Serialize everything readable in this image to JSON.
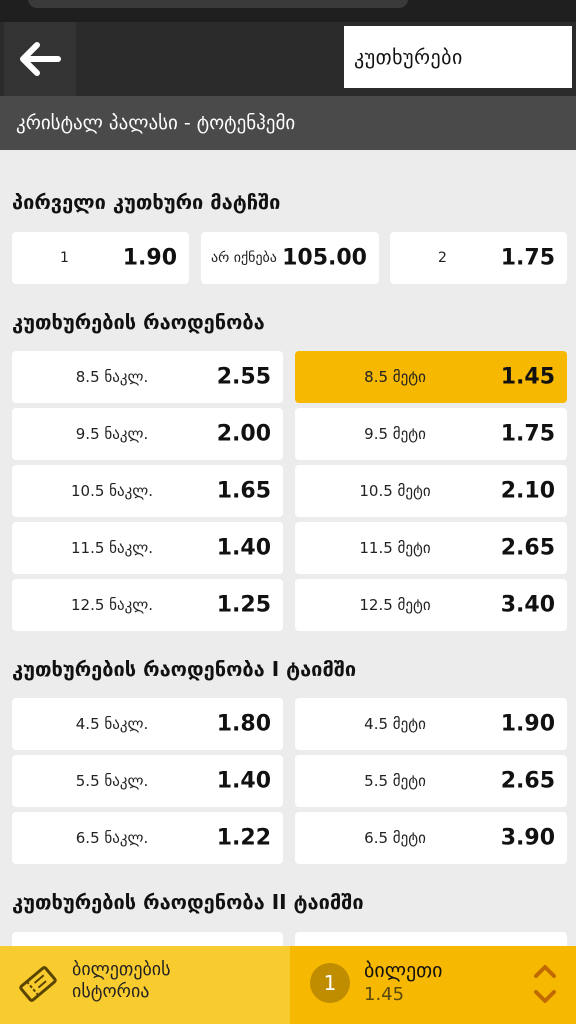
{
  "header": {
    "tab_label": "კუთხურები",
    "match_title": "კრისტალ პალასი - ტოტენჰემი"
  },
  "first_corner": {
    "title": "პირველი კუთხური მატჩში",
    "options": [
      {
        "label": "1",
        "odd": "1.90"
      },
      {
        "label": "არ იქნება",
        "odd": "105.00"
      },
      {
        "label": "2",
        "odd": "1.75"
      }
    ]
  },
  "total_corners": {
    "title": "კუთხურების რაოდენობა",
    "rows": [
      {
        "under_label": "8.5 ნაკლ.",
        "under_odd": "2.55",
        "over_label": "8.5 მეტი",
        "over_odd": "1.45"
      },
      {
        "under_label": "9.5 ნაკლ.",
        "under_odd": "2.00",
        "over_label": "9.5 მეტი",
        "over_odd": "1.75"
      },
      {
        "under_label": "10.5 ნაკლ.",
        "under_odd": "1.65",
        "over_label": "10.5 მეტი",
        "over_odd": "2.10"
      },
      {
        "under_label": "11.5 ნაკლ.",
        "under_odd": "1.40",
        "over_label": "11.5 მეტი",
        "over_odd": "2.65"
      },
      {
        "under_label": "12.5 ნაკლ.",
        "under_odd": "1.25",
        "over_label": "12.5 მეტი",
        "over_odd": "3.40"
      }
    ]
  },
  "first_half": {
    "title": "კუთხურების რაოდენობა I ტაიმში",
    "rows": [
      {
        "under_label": "4.5 ნაკლ.",
        "under_odd": "1.80",
        "over_label": "4.5 მეტი",
        "over_odd": "1.90"
      },
      {
        "under_label": "5.5 ნაკლ.",
        "under_odd": "1.40",
        "over_label": "5.5 მეტი",
        "over_odd": "2.65"
      },
      {
        "under_label": "6.5 ნაკლ.",
        "under_odd": "1.22",
        "over_label": "6.5 მეტი",
        "over_odd": "3.90"
      }
    ]
  },
  "second_half": {
    "title": "კუთხურების რაოდენობა II ტაიმში"
  },
  "footer": {
    "history_label_line1": "ბილეთების",
    "history_label_line2": "ისტორია",
    "ticket_count": "1",
    "ticket_label": "ბილეთი",
    "ticket_total": "1.45"
  },
  "colors": {
    "accent": "#f6b800",
    "header_bg": "#2b2b2b",
    "subheader_bg": "#4a4a4a"
  },
  "icons": {
    "back": "arrow-left-icon",
    "history": "ticket-icon",
    "expand": "chevron-up-down-icon"
  }
}
